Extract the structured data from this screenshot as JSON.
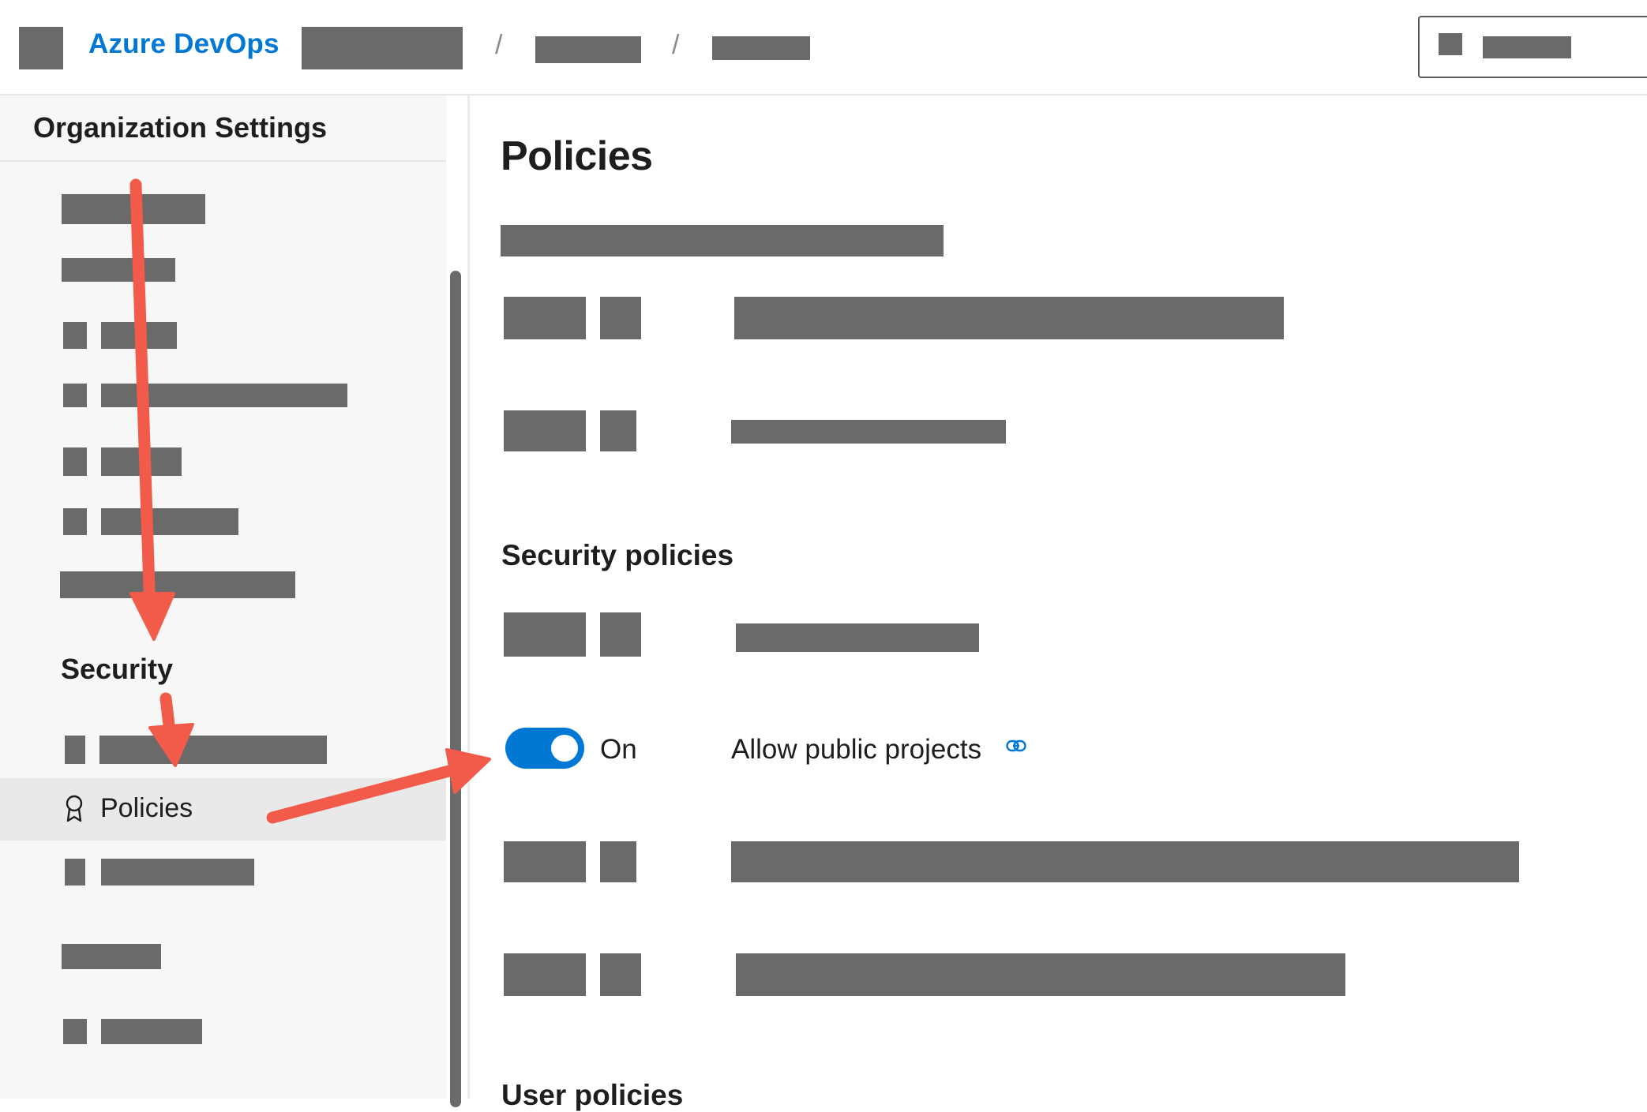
{
  "header": {
    "app_name": "Azure DevOps",
    "separators": [
      "/",
      "/"
    ]
  },
  "sidebar": {
    "title": "Organization Settings",
    "section_heading": "Security",
    "selected_item": {
      "label": "Policies",
      "icon": "ribbon-icon"
    }
  },
  "main": {
    "page_title": "Policies",
    "section_heading": "Security policies",
    "next_section_heading": "User policies",
    "policy": {
      "toggle_state": "On",
      "label": "Allow public projects",
      "icon": "link-icon"
    }
  },
  "colors": {
    "accent": "#0078d4",
    "annotation_arrow": "#f25a4a",
    "redaction": "#6a6a6a"
  }
}
